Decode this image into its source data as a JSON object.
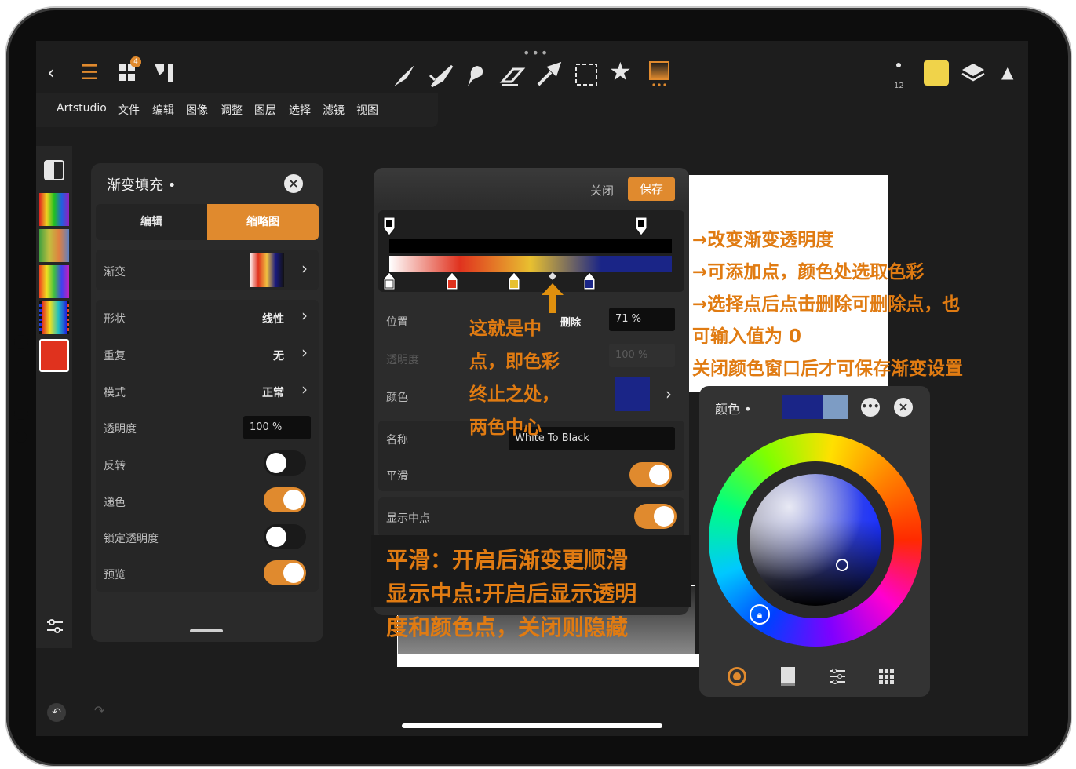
{
  "menu": {
    "items": [
      "Artstudio",
      "文件",
      "编辑",
      "图像",
      "调整",
      "图层",
      "选择",
      "滤镜",
      "视图"
    ],
    "badge": "4",
    "brush_size": "12"
  },
  "colors": {
    "accent": "#e08a2e",
    "annotation": "#e07b12",
    "current_color": "#f0d34a"
  },
  "gradient_panel": {
    "title": "渐变填充 •",
    "tab_edit": "编辑",
    "tab_thumb": "缩略图",
    "gradient_label": "渐变",
    "shape_label": "形状",
    "shape_value": "线性",
    "repeat_label": "重复",
    "repeat_value": "无",
    "mode_label": "模式",
    "mode_value": "正常",
    "opacity_label": "透明度",
    "opacity_value": "100 %",
    "invert_label": "反转",
    "invert_on": false,
    "dither_label": "递色",
    "dither_on": true,
    "lock_label": "锁定透明度",
    "lock_on": false,
    "preview_label": "预览",
    "preview_on": true
  },
  "editor": {
    "close": "关闭",
    "save": "保存",
    "position_label": "位置",
    "delete": "删除",
    "position_value": "71 %",
    "opacity_label": "透明度",
    "opacity_value": "100 %",
    "color_label": "颜色",
    "name_label": "名称",
    "name_value": "White To Black",
    "smooth_label": "平滑",
    "smooth_on": true,
    "show_mid_label": "显示中点",
    "show_mid_on": true
  },
  "color_panel": {
    "title": "颜色 •",
    "swatch_primary": "#1a2587",
    "swatch_secondary": "#7d9cc4"
  },
  "annotations": {
    "mid": [
      "这就是中",
      "点，即色彩",
      "终止之处，",
      "两色中心"
    ],
    "right": [
      "→改变渐变透明度",
      "→可添加点，颜色处选取色彩",
      "→选择点后点击删除可删除点，也",
      "可输入值为 0",
      "关闭颜色窗口后才可保存渐变设置"
    ],
    "bottom": [
      "平滑：开启后渐变更顺滑",
      "显示中点:开启后显示透明",
      "度和颜色点，关闭则隐藏"
    ]
  }
}
